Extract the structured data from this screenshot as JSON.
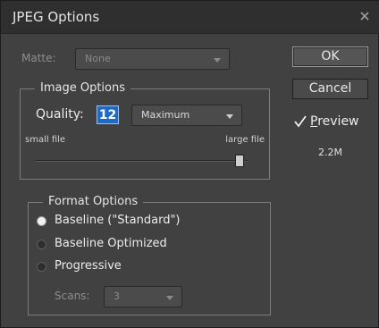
{
  "window": {
    "title": "JPEG Options",
    "close_icon": "close-icon"
  },
  "matte": {
    "label": "Matte:",
    "value": "None"
  },
  "image_options": {
    "heading": "Image Options",
    "quality_label": "Quality:",
    "quality_value": "12",
    "quality_preset": "Maximum",
    "small_file_label": "small file",
    "large_file_label": "large file",
    "quality_level_percent": 100
  },
  "buttons": {
    "ok": "OK",
    "cancel": "Cancel"
  },
  "preview": {
    "label": "Preview",
    "checked": true,
    "file_size": "2.2M"
  },
  "format_options": {
    "heading": "Format Options",
    "options": [
      {
        "label": "Baseline (\"Standard\")",
        "selected": true
      },
      {
        "label": "Baseline Optimized",
        "selected": false
      },
      {
        "label": "Progressive",
        "selected": false
      }
    ],
    "scans_label": "Scans:",
    "scans_value": "3"
  }
}
